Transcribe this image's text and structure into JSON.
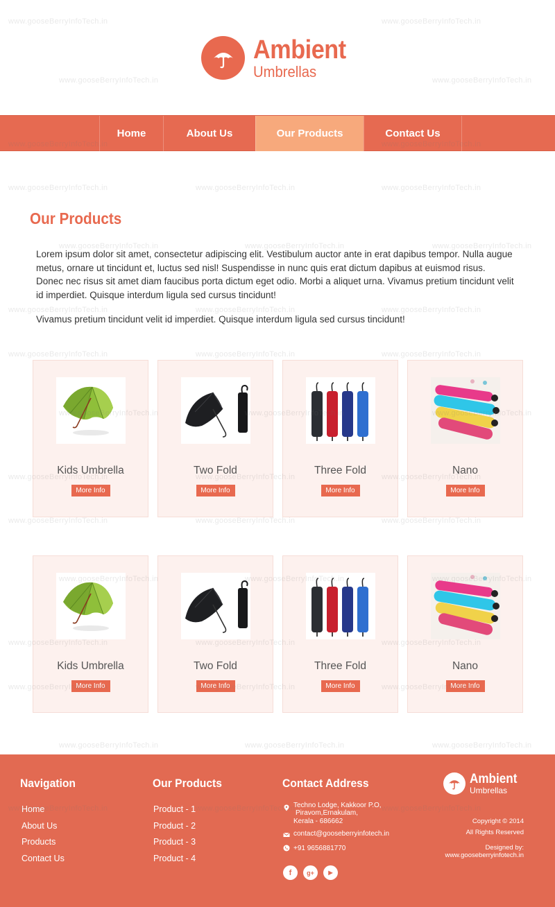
{
  "brand": {
    "name": "Ambient",
    "tagline": "Umbrellas",
    "accent": "#e8694f",
    "nav_active": "#f7a97c",
    "card_bg": "#fdf1ee"
  },
  "watermark": "www.gooseBerryInfoTech.in",
  "nav": {
    "items": [
      {
        "label": "Home",
        "active": false
      },
      {
        "label": "About Us",
        "active": false
      },
      {
        "label": "Our Products",
        "active": true
      },
      {
        "label": "Contact Us",
        "active": false
      }
    ]
  },
  "main": {
    "title": "Our Products",
    "paragraph1": "Lorem ipsum dolor sit amet, consectetur adipiscing elit. Vestibulum auctor ante in erat dapibus tempor. Nulla augue metus, ornare ut tincidunt et, luctus sed nisl! Suspendisse in nunc quis erat dictum dapibus at euismod risus. Donec nec risus sit amet diam faucibus porta dictum eget odio. Morbi a aliquet urna. Vivamus pretium tincidunt velit id imperdiet. Quisque interdum ligula sed cursus tincidunt!",
    "paragraph2": "Vivamus pretium tincidunt velit id imperdiet. Quisque interdum ligula sed cursus tincidunt!",
    "more_info_label": "More Info",
    "products": [
      {
        "name": "Kids Umbrella",
        "image": "green-umbrella"
      },
      {
        "name": "Two Fold",
        "image": "black-folding-umbrella"
      },
      {
        "name": "Three Fold",
        "image": "colored-folded-umbrellas"
      },
      {
        "name": "Nano",
        "image": "nano-umbrellas"
      },
      {
        "name": "Kids Umbrella",
        "image": "green-umbrella"
      },
      {
        "name": "Two Fold",
        "image": "black-folding-umbrella"
      },
      {
        "name": "Three Fold",
        "image": "colored-folded-umbrellas"
      },
      {
        "name": "Nano",
        "image": "nano-umbrellas"
      }
    ]
  },
  "footer": {
    "navigation": {
      "title": "Navigation",
      "links": [
        "Home",
        "About Us",
        "Products",
        "Contact Us"
      ]
    },
    "products": {
      "title": "Our Products",
      "links": [
        "Product - 1",
        "Product - 2",
        "Product - 3",
        "Product - 4"
      ]
    },
    "contact": {
      "title": "Contact Address",
      "address_line1": "Techno Lodge, Kakkoor P.O,",
      "address_line2": "Piravom,Ernakulam,",
      "address_line3": "Kerala - 686662",
      "email": "contact@gooseberryinfotech.in",
      "phone": "+91 9656881770",
      "social": [
        "facebook-icon",
        "google-plus-icon",
        "youtube-icon"
      ]
    },
    "copyright": "Copyright © 2014",
    "rights": "All Rights Reserved",
    "designed_by": "Designed by:",
    "designer_url": "www.gooseberryinfotech.in"
  }
}
